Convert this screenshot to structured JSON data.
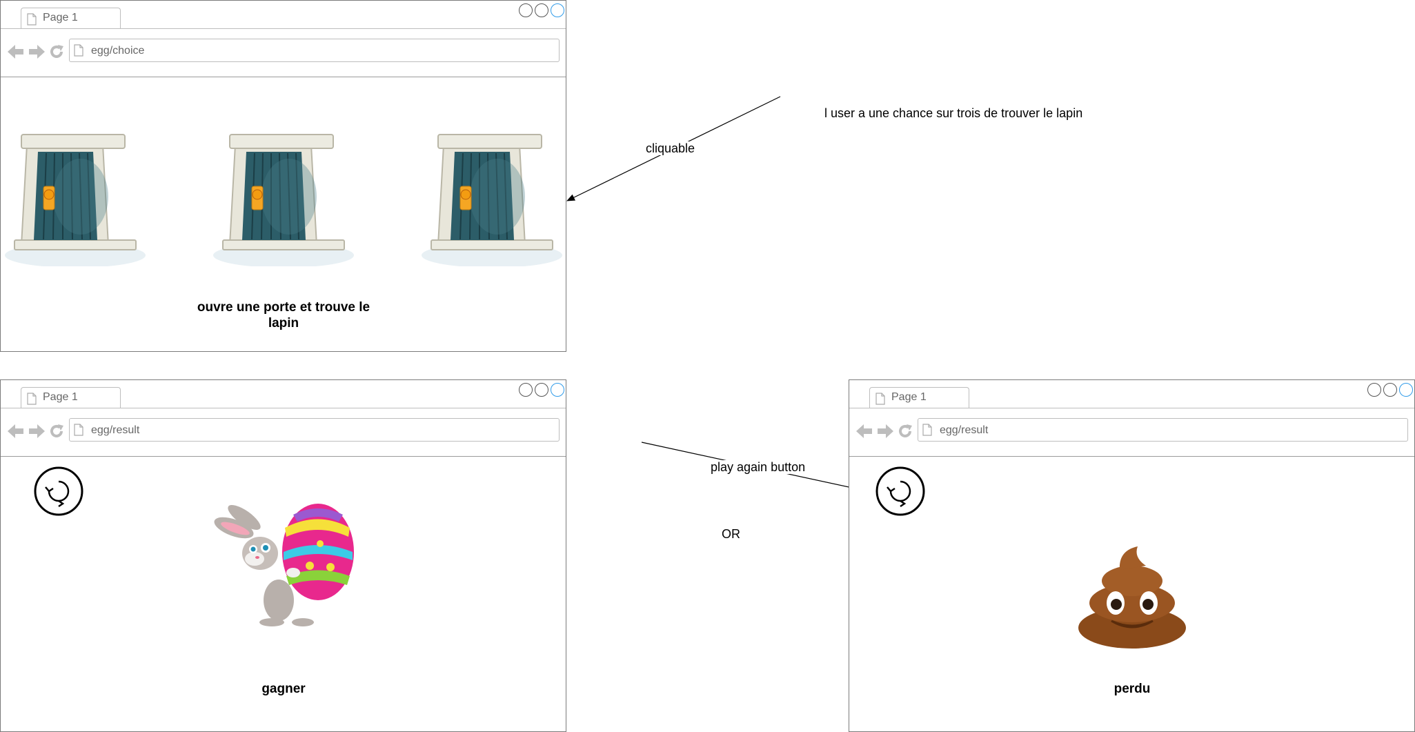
{
  "windows": {
    "choice": {
      "tab_label": "Page 1",
      "url": "egg/choice",
      "caption": "ouvre une porte et trouve le lapin"
    },
    "win": {
      "tab_label": "Page 1",
      "url": "egg/result",
      "caption": "gagner"
    },
    "lose": {
      "tab_label": "Page 1",
      "url": "egg/result",
      "caption": "perdu"
    }
  },
  "annotations": {
    "chance": "l user a une chance sur trois de trouver le lapin",
    "cliquable": "cliquable",
    "play_again": "play again button",
    "or": "OR"
  },
  "colors": {
    "window_border": "#7a7a7a",
    "active_window_button": "#2f9be9",
    "door_panel": "#2c5d68",
    "door_frame": "#e8e6da",
    "egg_pink": "#e8288d",
    "poop_brown": "#8a4a1a"
  },
  "icons": [
    "page-icon",
    "back-arrow-icon",
    "forward-arrow-icon",
    "reload-icon",
    "door-icon",
    "replay-icon",
    "bunny-egg-icon",
    "poop-icon"
  ]
}
